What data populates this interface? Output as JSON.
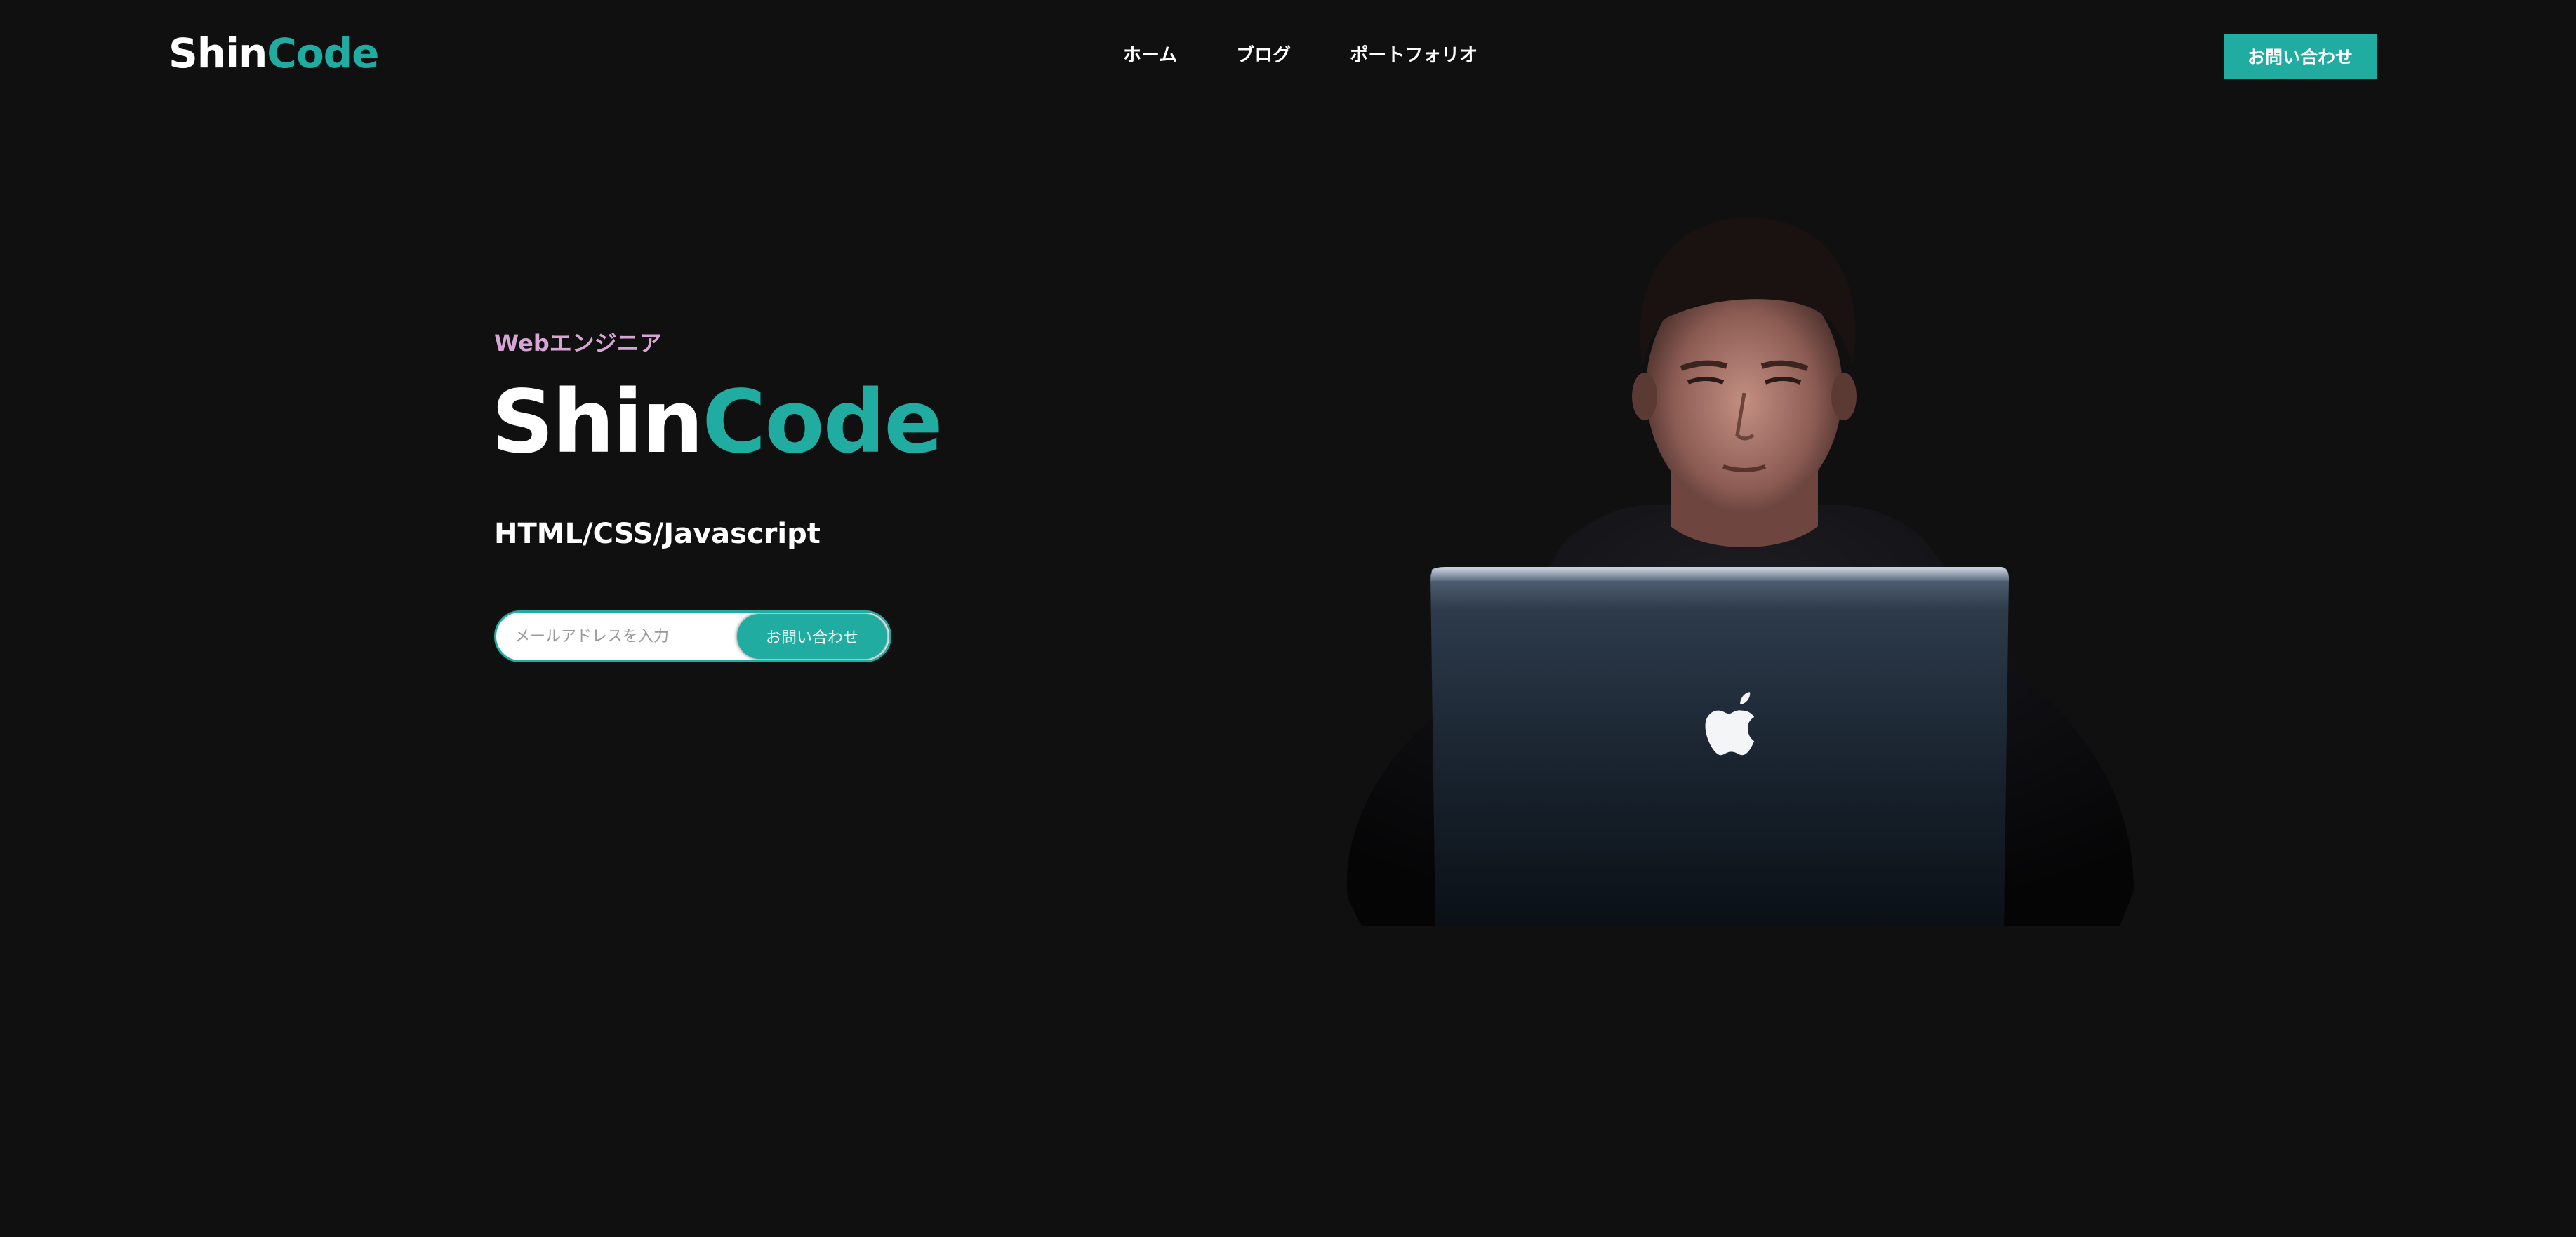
{
  "header": {
    "logo_part1": "Shin",
    "logo_part2": "Code",
    "nav": [
      {
        "label": "ホーム"
      },
      {
        "label": "ブログ"
      },
      {
        "label": "ポートフォリオ"
      }
    ],
    "cta_label": "お問い合わせ"
  },
  "hero": {
    "subtitle": "Webエンジニア",
    "title_part1": "Shin",
    "title_part2": "Code",
    "skills": "HTML/CSS/Javascript",
    "email_placeholder": "メールアドレスを入力",
    "submit_label": "お問い合わせ"
  },
  "colors": {
    "background": "#101010",
    "accent": "#20aca0",
    "subtitle": "#d7a4d6",
    "text": "#ffffff"
  },
  "icons": [
    "apple-logo-icon"
  ]
}
